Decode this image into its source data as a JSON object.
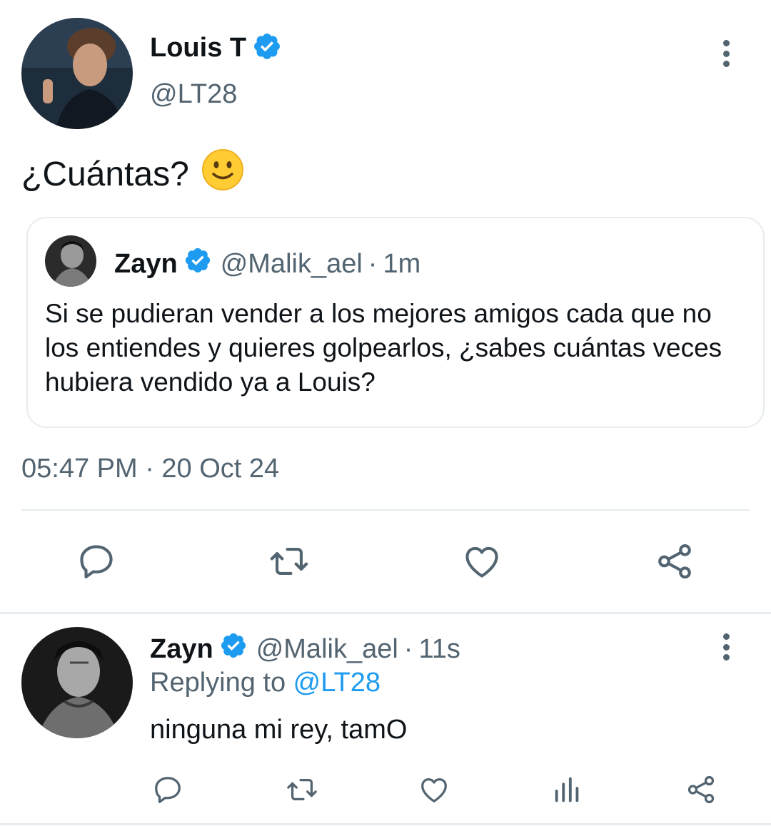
{
  "main_tweet": {
    "author_name": "Louis T",
    "author_handle": "@LT28",
    "text": "¿Cuántas? ",
    "emoji": "🙂",
    "quoted": {
      "author_name": "Zayn",
      "author_handle": "@Malik_ael",
      "separator": "·",
      "time": "1m",
      "text": "Si se pudieran vender a los mejores amigos cada que no los entiendes y quieres golpearlos, ¿sabes cuántas veces hubiera vendido ya a Louis?"
    },
    "timestamp": "05:47 PM · 20 Oct 24",
    "actions": [
      "reply-icon",
      "retweet-icon",
      "like-icon",
      "share-icon"
    ]
  },
  "reply_tweet": {
    "author_name": "Zayn",
    "author_handle": "@Malik_ael",
    "separator": "·",
    "time": "11s",
    "replying_prefix": "Replying to ",
    "replying_to": "@LT28",
    "text": "ninguna mi rey, tamO",
    "actions": [
      "reply-icon",
      "retweet-icon",
      "like-icon",
      "analytics-icon",
      "share-icon"
    ]
  },
  "colors": {
    "accent": "#1d9bf0",
    "muted": "#536471",
    "divider": "#e6ecf0",
    "text": "#0f1419"
  }
}
